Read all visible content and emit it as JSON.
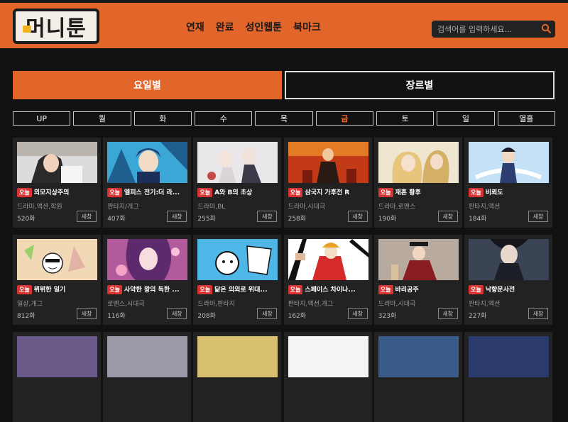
{
  "header": {
    "logo_text": "머니툰",
    "nav": [
      "연재",
      "완료",
      "성인웹툰",
      "북마크"
    ],
    "search": {
      "placeholder": "검색어를 입력하세요...",
      "value": ""
    }
  },
  "mode_tabs": {
    "by_day": "요일별",
    "by_genre": "장르별",
    "active": "by_day"
  },
  "day_tabs": {
    "items": [
      "UP",
      "월",
      "화",
      "수",
      "목",
      "금",
      "토",
      "일",
      "열흘"
    ],
    "active": "금"
  },
  "colors": {
    "accent": "#e2652a",
    "badge": "#d93333",
    "background": "#111111",
    "card": "#222222"
  },
  "cards": [
    {
      "badge": "오늘",
      "title": "외모지상주의",
      "genre": "드라마,액션,학원",
      "count": "520화",
      "new_label": "새창",
      "thumb": "boy-portrait"
    },
    {
      "badge": "오늘",
      "title": "엘피스 전기:더 라...",
      "genre": "판타지/개그",
      "count": "407화",
      "new_label": "새창",
      "thumb": "blue-boy"
    },
    {
      "badge": "오늘",
      "title": "A와 B의 초상",
      "genre": "드라마,BL",
      "count": "255화",
      "new_label": "새창",
      "thumb": "pale-pair"
    },
    {
      "badge": "오늘",
      "title": "삼국지 가후전 R",
      "genre": "드라마,시대극",
      "count": "258화",
      "new_label": "새창",
      "thumb": "red-warrior"
    },
    {
      "badge": "오늘",
      "title": "재혼 황후",
      "genre": "드라마,로맨스",
      "count": "190화",
      "new_label": "새창",
      "thumb": "blonde-couple"
    },
    {
      "badge": "오늘",
      "title": "비뢰도",
      "genre": "판타지,액션",
      "count": "184화",
      "new_label": "새창",
      "thumb": "magic-boy"
    },
    {
      "badge": "오늘",
      "title": "뷔뷔한 일기",
      "genre": "일상,개그",
      "count": "812화",
      "new_label": "새창",
      "thumb": "cartoon-cat"
    },
    {
      "badge": "오늘",
      "title": "사악한 왕의 독한 ...",
      "genre": "로맨스,시대극",
      "count": "116화",
      "new_label": "새창",
      "thumb": "pink-lady"
    },
    {
      "badge": "오늘",
      "title": "닮은 의외로 위대...",
      "genre": "드라마,판타지",
      "count": "208화",
      "new_label": "새창",
      "thumb": "sketch"
    },
    {
      "badge": "오늘",
      "title": "스페이스 차이나...",
      "genre": "판타지,액션,개그",
      "count": "162화",
      "new_label": "새창",
      "thumb": "china-girl"
    },
    {
      "badge": "오늘",
      "title": "바리공주",
      "genre": "드라마,시대극",
      "count": "323화",
      "new_label": "새창",
      "thumb": "hanbok"
    },
    {
      "badge": "오늘",
      "title": "낙향문사전",
      "genre": "판타지,액션",
      "count": "227화",
      "new_label": "새창",
      "thumb": "swordsman"
    }
  ]
}
